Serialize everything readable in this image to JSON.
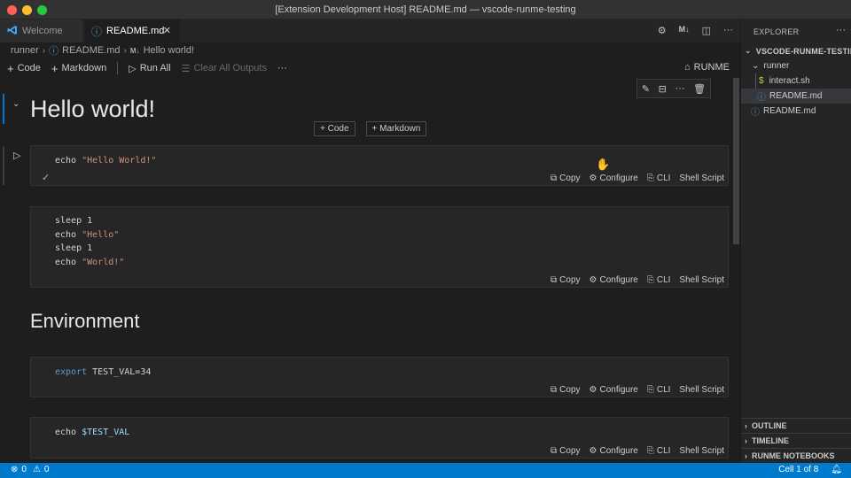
{
  "window": {
    "title": "[Extension Development Host] README.md — vscode-runme-testing"
  },
  "tabs": [
    {
      "label": "Welcome",
      "icon": "vscode-logo-icon",
      "active": false
    },
    {
      "label": "README.md",
      "icon": "info-icon",
      "active": true
    }
  ],
  "tab_actions": {
    "markdown_label": "M↓"
  },
  "breadcrumbs": [
    "runner",
    "README.md",
    "Hello world!"
  ],
  "toolbar": {
    "code_label": "Code",
    "markdown_label": "Markdown",
    "run_all_label": "Run All",
    "clear_outputs_label": "Clear All Outputs",
    "more_label": "···",
    "runme_label": "RUNME"
  },
  "notebook": {
    "heading1": "Hello world!",
    "heading2": "Environment",
    "insert_code_label": "Code",
    "insert_markdown_label": "Markdown",
    "cell_actions": {
      "copy": "Copy",
      "configure": "Configure",
      "cli": "CLI",
      "shell_script": "Shell Script"
    },
    "cells": [
      {
        "lines": [
          [
            [
              "echo ",
              "plain"
            ],
            [
              "\"Hello World!\"",
              "str"
            ]
          ]
        ]
      },
      {
        "lines": [
          [
            [
              "sleep 1",
              "plain"
            ]
          ],
          [
            [
              "echo ",
              "plain"
            ],
            [
              "\"Hello\"",
              "str"
            ]
          ],
          [
            [
              "sleep 1",
              "plain"
            ]
          ],
          [
            [
              "echo ",
              "plain"
            ],
            [
              "\"World!\"",
              "str"
            ]
          ]
        ]
      },
      {
        "lines": [
          [
            [
              "export",
              "kw"
            ],
            [
              " TEST_VAL=34",
              "plain"
            ]
          ]
        ]
      },
      {
        "lines": [
          [
            [
              "echo ",
              "plain"
            ],
            [
              "$TEST_VAL",
              "var"
            ]
          ]
        ]
      }
    ]
  },
  "explorer": {
    "header": "EXPLORER",
    "root": "VSCODE-RUNME-TESTING",
    "items": [
      {
        "label": "runner",
        "type": "folder"
      },
      {
        "label": "interact.sh",
        "type": "file-sh"
      },
      {
        "label": "README.md",
        "type": "file-md",
        "selected": true
      },
      {
        "label": "README.md",
        "type": "file-md"
      }
    ],
    "sections": [
      "OUTLINE",
      "TIMELINE",
      "RUNME NOTEBOOKS"
    ]
  },
  "status": {
    "errors": "0",
    "warnings": "0",
    "cell_position": "Cell 1 of 8"
  },
  "colors": {
    "accent": "#007acc",
    "editor_bg": "#1e1e1e",
    "string": "#ce9178",
    "keyword": "#569cd6",
    "variable": "#9cdcfe"
  }
}
